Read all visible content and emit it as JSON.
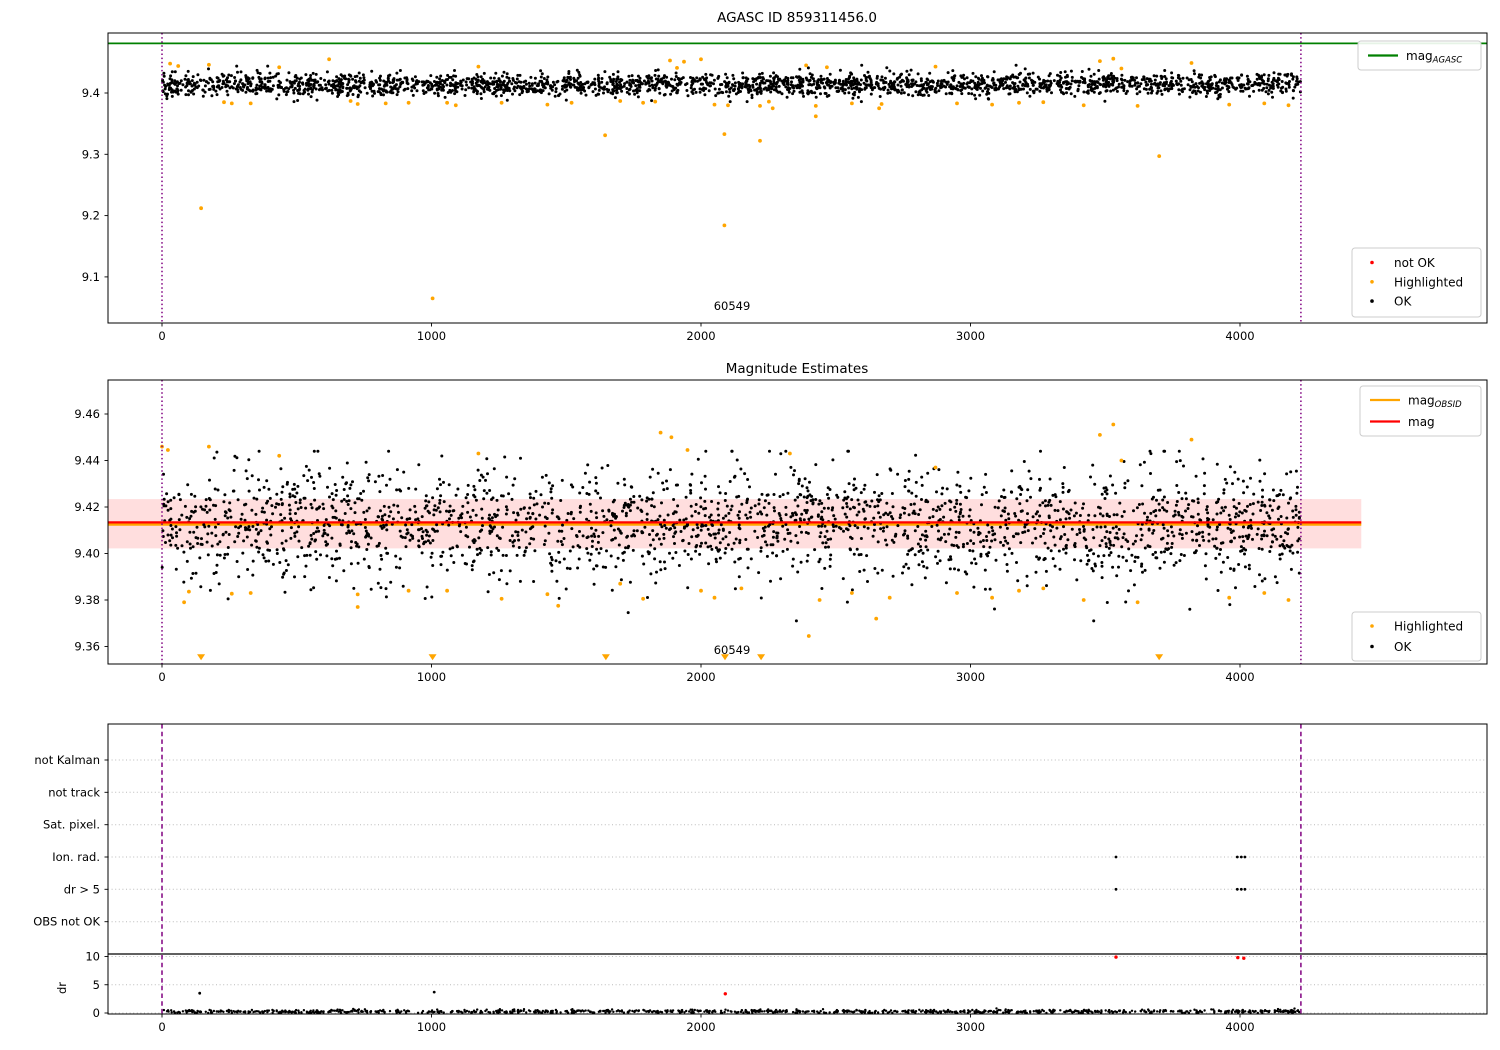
{
  "colors": {
    "ok": "#000000",
    "highlighted": "#FFA500",
    "not_ok": "#FF0000",
    "mag_agasc_line": "#008000",
    "mag_obsid_line": "#FFA500",
    "mag_line": "#FF0000",
    "mag_band": "rgba(255,0,0,0.13)",
    "obsid_vline": "#800080",
    "grid": "#bbbbbb",
    "legend_border": "#cccccc",
    "axes": "#000000"
  },
  "chart_data": [
    {
      "id": "mag-history",
      "type": "scatter",
      "title": "AGASC ID 859311456.0",
      "xlim": [
        -200,
        4917
      ],
      "ylim": [
        9.025,
        9.498
      ],
      "xticks": [
        {
          "v": 0,
          "label": "0"
        },
        {
          "v": 1000,
          "label": "1000"
        },
        {
          "v": 2000,
          "label": "2000"
        },
        {
          "v": 3000,
          "label": "3000"
        },
        {
          "v": 4000,
          "label": "4000"
        }
      ],
      "yticks": [
        {
          "v": 9.1,
          "label": "9.1"
        },
        {
          "v": 9.2,
          "label": "9.2"
        },
        {
          "v": 9.3,
          "label": "9.3"
        },
        {
          "v": 9.4,
          "label": "9.4"
        }
      ],
      "mag_agasc": 9.481,
      "obsid_vlines": [
        0,
        4226
      ],
      "obsid_label": {
        "text": "60549",
        "x": 2114,
        "y": 9.055
      },
      "legend_lines": [
        {
          "label_main": "mag",
          "label_sub": "AGASC",
          "color": "#008000"
        }
      ],
      "legend_markers": [
        {
          "label": "not OK",
          "color": "#FF0000"
        },
        {
          "label": "Highlighted",
          "color": "#FFA500"
        },
        {
          "label": "OK",
          "color": "#000000"
        }
      ],
      "ok_cloud": {
        "n": 2500,
        "x_min": 0,
        "x_max": 4226,
        "y_mean": 9.4135,
        "y_std": 0.009,
        "y_clip": [
          9.386,
          9.4455
        ],
        "seed": 7
      },
      "not_ok_points": [],
      "highlighted_points": [
        [
          30,
          9.448
        ],
        [
          60,
          9.444
        ],
        [
          145,
          9.212
        ],
        [
          174,
          9.446
        ],
        [
          230,
          9.385
        ],
        [
          259,
          9.383
        ],
        [
          329,
          9.383
        ],
        [
          435,
          9.442
        ],
        [
          620,
          9.455
        ],
        [
          700,
          9.387
        ],
        [
          726,
          9.382
        ],
        [
          830,
          9.383
        ],
        [
          915,
          9.384
        ],
        [
          1004,
          9.065
        ],
        [
          1058,
          9.384
        ],
        [
          1090,
          9.38
        ],
        [
          1174,
          9.443
        ],
        [
          1260,
          9.384
        ],
        [
          1430,
          9.381
        ],
        [
          1520,
          9.384
        ],
        [
          1644,
          9.331
        ],
        [
          1700,
          9.387
        ],
        [
          1785,
          9.384
        ],
        [
          1830,
          9.386
        ],
        [
          1885,
          9.453
        ],
        [
          1911,
          9.441
        ],
        [
          1937,
          9.451
        ],
        [
          2000,
          9.455
        ],
        [
          2050,
          9.381
        ],
        [
          2087,
          9.333
        ],
        [
          2087,
          9.184
        ],
        [
          2100,
          9.38
        ],
        [
          2219,
          9.322
        ],
        [
          2219,
          9.379
        ],
        [
          2252,
          9.386
        ],
        [
          2266,
          9.375
        ],
        [
          2390,
          9.445
        ],
        [
          2426,
          9.379
        ],
        [
          2426,
          9.362
        ],
        [
          2467,
          9.442
        ],
        [
          2560,
          9.383
        ],
        [
          2661,
          9.375
        ],
        [
          2670,
          9.382
        ],
        [
          2870,
          9.443
        ],
        [
          2950,
          9.383
        ],
        [
          3080,
          9.381
        ],
        [
          3180,
          9.384
        ],
        [
          3270,
          9.385
        ],
        [
          3420,
          9.38
        ],
        [
          3480,
          9.452
        ],
        [
          3530,
          9.456
        ],
        [
          3560,
          9.44
        ],
        [
          3620,
          9.379
        ],
        [
          3700,
          9.297
        ],
        [
          3820,
          9.449
        ],
        [
          3960,
          9.381
        ],
        [
          4090,
          9.383
        ],
        [
          4180,
          9.38
        ]
      ]
    },
    {
      "id": "magnitude-estimates",
      "type": "scatter",
      "title": "Magnitude Estimates",
      "xlim": [
        -200,
        4917
      ],
      "ylim": [
        9.3525,
        9.4746
      ],
      "xticks": [
        {
          "v": 0,
          "label": "0"
        },
        {
          "v": 1000,
          "label": "1000"
        },
        {
          "v": 2000,
          "label": "2000"
        },
        {
          "v": 3000,
          "label": "3000"
        },
        {
          "v": 4000,
          "label": "4000"
        }
      ],
      "yticks": [
        {
          "v": 9.36,
          "label": "9.36"
        },
        {
          "v": 9.38,
          "label": "9.38"
        },
        {
          "v": 9.4,
          "label": "9.40"
        },
        {
          "v": 9.42,
          "label": "9.42"
        },
        {
          "v": 9.44,
          "label": "9.44"
        },
        {
          "v": 9.46,
          "label": "9.46"
        }
      ],
      "mag": 9.4134,
      "mag_obsid": 9.4125,
      "mag_band": [
        9.4022,
        9.4234
      ],
      "mag_line_span": [
        -200,
        4450
      ],
      "obsid_vlines": [
        0,
        4226
      ],
      "obsid_label": {
        "text": "60549",
        "x": 2114,
        "y": 9.357
      },
      "legend_lines": [
        {
          "label_main": "mag",
          "label_sub": "OBSID",
          "color": "#FFA500"
        },
        {
          "label_main": "mag",
          "label_sub": "",
          "color": "#FF0000"
        }
      ],
      "legend_markers": [
        {
          "label": "Highlighted",
          "color": "#FFA500"
        },
        {
          "label": "OK",
          "color": "#000000"
        }
      ],
      "ok_cloud": {
        "n": 2300,
        "x_min": 0,
        "x_max": 4226,
        "y_mean": 9.4128,
        "y_std": 0.012,
        "y_clip": [
          9.371,
          9.444
        ],
        "seed": 13
      },
      "highlighted_points": [
        [
          0,
          9.446
        ],
        [
          22,
          9.4445
        ],
        [
          82,
          9.379
        ],
        [
          100,
          9.3836
        ],
        [
          174,
          9.446
        ],
        [
          259,
          9.3827
        ],
        [
          329,
          9.383
        ],
        [
          435,
          9.442
        ],
        [
          726,
          9.3824
        ],
        [
          726,
          9.377
        ],
        [
          915,
          9.384
        ],
        [
          1058,
          9.384
        ],
        [
          1174,
          9.443
        ],
        [
          1260,
          9.3805
        ],
        [
          1430,
          9.3825
        ],
        [
          1470,
          9.3775
        ],
        [
          1700,
          9.387
        ],
        [
          1785,
          9.3805
        ],
        [
          1850,
          9.452
        ],
        [
          1890,
          9.45
        ],
        [
          1950,
          9.4445
        ],
        [
          2000,
          9.384
        ],
        [
          2050,
          9.381
        ],
        [
          2150,
          9.385
        ],
        [
          2330,
          9.443
        ],
        [
          2400,
          9.3645
        ],
        [
          2440,
          9.38
        ],
        [
          2560,
          9.383
        ],
        [
          2650,
          9.372
        ],
        [
          2700,
          9.381
        ],
        [
          2870,
          9.437
        ],
        [
          2950,
          9.383
        ],
        [
          3080,
          9.381
        ],
        [
          3180,
          9.384
        ],
        [
          3270,
          9.385
        ],
        [
          3420,
          9.38
        ],
        [
          3480,
          9.451
        ],
        [
          3530,
          9.4555
        ],
        [
          3560,
          9.44
        ],
        [
          3620,
          9.379
        ],
        [
          3820,
          9.449
        ],
        [
          3960,
          9.381
        ],
        [
          4090,
          9.383
        ],
        [
          4180,
          9.38
        ]
      ],
      "clipped_below_x": [
        145,
        1004,
        1647,
        2089,
        2223,
        3700
      ],
      "clipped_below_y": 9.3558
    },
    {
      "id": "flags-and-dr",
      "type": "scatter",
      "flag_categories": [
        "not Kalman",
        "not track",
        "Sat. pixel.",
        "Ion. rad.",
        "dr > 5",
        "OBS not OK"
      ],
      "flag_points": {
        "ion_rad_x": [
          3540,
          3990,
          4005,
          4018
        ],
        "dr_gt_5_x": [
          3540,
          3990,
          4005,
          4018
        ]
      },
      "dr_axis_label": "dr",
      "dr_ticks": [
        {
          "v": 0,
          "label": "0"
        },
        {
          "v": 5,
          "label": "5"
        },
        {
          "v": 10,
          "label": "10"
        }
      ],
      "xticks": [
        {
          "v": 0,
          "label": "0"
        },
        {
          "v": 1000,
          "label": "1000"
        },
        {
          "v": 2000,
          "label": "2000"
        },
        {
          "v": 3000,
          "label": "3000"
        },
        {
          "v": 4000,
          "label": "4000"
        }
      ],
      "obsid_vlines": [
        0,
        4226
      ],
      "dr_cloud": {
        "n": 1000,
        "x_min": 0,
        "x_max": 4226,
        "y_mean": 0.27,
        "y_std": 0.17,
        "y_clip": [
          0.02,
          1.4
        ],
        "seed": 99
      },
      "dr_outliers_ok": [
        [
          140,
          3.5
        ],
        [
          1010,
          3.7
        ]
      ],
      "dr_outliers_not_ok": [
        [
          2090,
          3.4
        ],
        [
          3540,
          9.9
        ],
        [
          3992,
          9.8
        ],
        [
          4014,
          9.7
        ]
      ]
    }
  ]
}
